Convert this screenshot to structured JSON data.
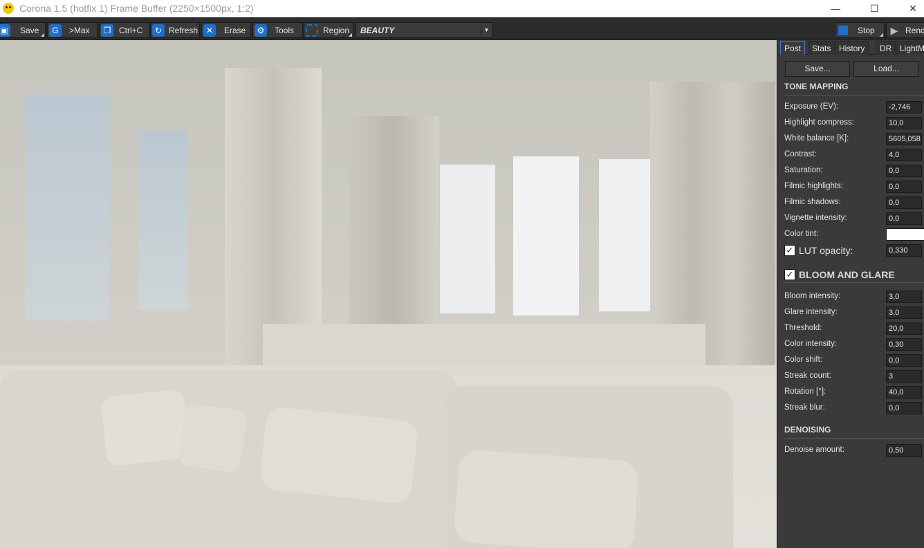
{
  "window": {
    "title": "Corona 1.5 (hotfix 1) Frame Buffer (2250×1500px, 1:2)",
    "minimize_glyph": "—",
    "maximize_glyph": "☐",
    "close_glyph": "✕"
  },
  "toolbar": {
    "save": "Save",
    "max": ">Max",
    "ctrlc": "Ctrl+C",
    "refresh": "Refresh",
    "erase": "Erase",
    "tools": "Tools",
    "region": "Region",
    "pass": "BEAUTY",
    "stop": "Stop",
    "render": "Rend"
  },
  "panel": {
    "tabs": [
      "Post",
      "Stats",
      "History",
      "DR",
      "LightM"
    ],
    "save_button": "Save...",
    "load_button": "Load...",
    "tone_mapping": {
      "title": "TONE MAPPING",
      "rows": [
        {
          "label": "Exposure (EV):",
          "value": "-2,746"
        },
        {
          "label": "Highlight compress:",
          "value": "10,0"
        },
        {
          "label": "White balance [K]:",
          "value": "5605,058"
        },
        {
          "label": "Contrast:",
          "value": "4,0"
        },
        {
          "label": "Saturation:",
          "value": "0,0"
        },
        {
          "label": "Filmic highlights:",
          "value": "0,0"
        },
        {
          "label": "Filmic shadows:",
          "value": "0,0"
        },
        {
          "label": "Vignette intensity:",
          "value": "0,0"
        }
      ],
      "color_tint_label": "Color tint:",
      "color_tint_value": "#ffffff",
      "lut_label": "LUT opacity:",
      "lut_value": "0,330",
      "lut_checked": true
    },
    "bloom": {
      "title": "BLOOM AND GLARE",
      "checked": true,
      "rows": [
        {
          "label": "Bloom intensity:",
          "value": "3,0"
        },
        {
          "label": "Glare intensity:",
          "value": "3,0"
        },
        {
          "label": "Threshold:",
          "value": "20,0"
        },
        {
          "label": "Color intensity:",
          "value": "0,30"
        },
        {
          "label": "Color shift:",
          "value": "0,0"
        },
        {
          "label": "Streak count:",
          "value": "3"
        },
        {
          "label": "Rotation [°]:",
          "value": "40,0"
        },
        {
          "label": "Streak blur:",
          "value": "0,0"
        }
      ]
    },
    "denoising": {
      "title": "DENOISING",
      "rows": [
        {
          "label": "Denoise amount:",
          "value": "0,50"
        }
      ]
    }
  },
  "colors": {
    "accent": "#1e6fc9",
    "panel_bg": "#3a3a3a",
    "toolbar_bg": "#2b2b2b",
    "render_tone": "#d4d2ca"
  }
}
